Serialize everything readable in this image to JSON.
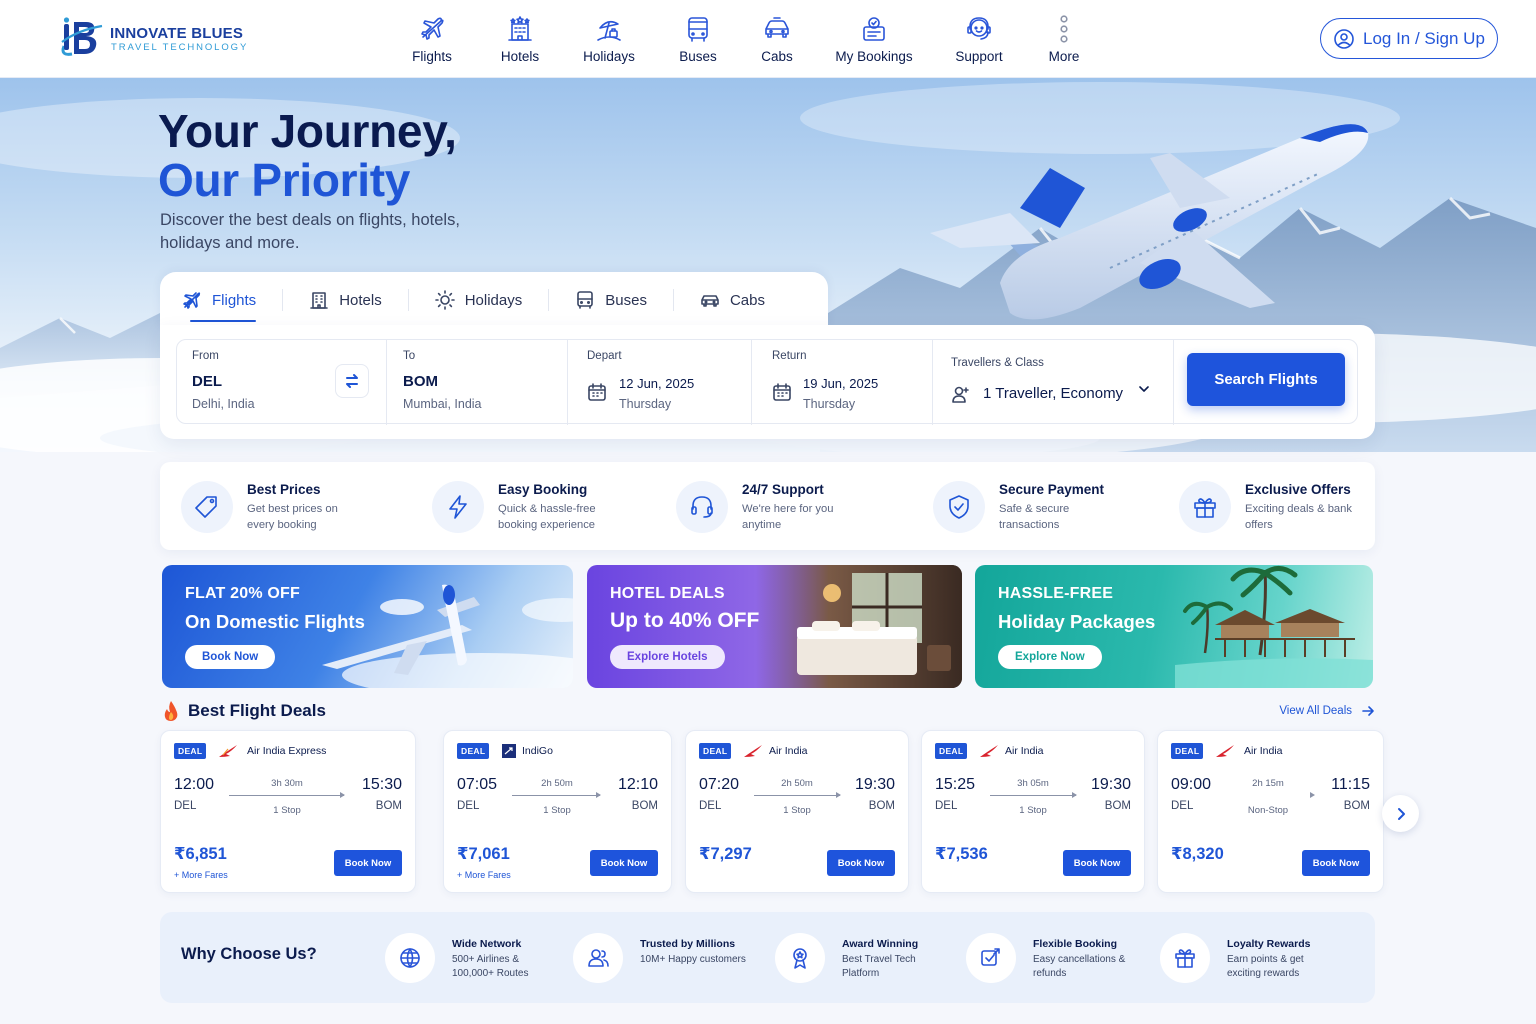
{
  "brand": {
    "name": "INNOVATE BLUES",
    "tagline": "TRAVEL TECHNOLOGY"
  },
  "nav": [
    {
      "label": "Flights",
      "icon": "flight-icon"
    },
    {
      "label": "Hotels",
      "icon": "hotel-icon"
    },
    {
      "label": "Holidays",
      "icon": "holiday-icon"
    },
    {
      "label": "Buses",
      "icon": "bus-icon"
    },
    {
      "label": "Cabs",
      "icon": "cab-icon"
    },
    {
      "label": "My Bookings",
      "icon": "bookings-icon"
    },
    {
      "label": "Support",
      "icon": "support-icon"
    },
    {
      "label": "More",
      "icon": "more-icon"
    }
  ],
  "login_label": "Log In / Sign Up",
  "hero": {
    "title_line1": "Your Journey,",
    "title_line2": "Our Priority",
    "subtitle": "Discover the best deals on flights, hotels, holidays and more."
  },
  "tabs": [
    "Flights",
    "Hotels",
    "Holidays",
    "Buses",
    "Cabs"
  ],
  "search": {
    "from": {
      "label": "From",
      "code": "DEL",
      "city": "Delhi, India"
    },
    "to": {
      "label": "To",
      "code": "BOM",
      "city": "Mumbai, India"
    },
    "depart": {
      "label": "Depart",
      "date": "12 Jun, 2025",
      "day": "Thursday"
    },
    "return": {
      "label": "Return",
      "date": "19 Jun, 2025",
      "day": "Thursday"
    },
    "travellers": {
      "label": "Travellers & Class",
      "value": "1 Traveller, Economy"
    },
    "button": "Search Flights"
  },
  "features": [
    {
      "title": "Best Prices",
      "desc": "Get best prices on every booking",
      "icon": "price-tag-icon"
    },
    {
      "title": "Easy Booking",
      "desc": "Quick & hassle-free booking experience",
      "icon": "lightning-icon"
    },
    {
      "title": "24/7 Support",
      "desc": "We're here for you anytime",
      "icon": "headset-icon"
    },
    {
      "title": "Secure Payment",
      "desc": "Safe & secure transactions",
      "icon": "shield-icon"
    },
    {
      "title": "Exclusive Offers",
      "desc": "Exciting deals & bank offers",
      "icon": "gift-icon"
    }
  ],
  "promos": [
    {
      "kicker": "FLAT 20% OFF",
      "headline": "On Domestic Flights",
      "button": "Book Now"
    },
    {
      "kicker": "HOTEL DEALS",
      "headline": "Up to 40% OFF",
      "button": "Explore Hotels"
    },
    {
      "kicker": "HASSLE-FREE",
      "headline": "Holiday Packages",
      "button": "Explore Now"
    }
  ],
  "deals": {
    "title": "Best Flight Deals",
    "view_all": "View All Deals",
    "badge": "DEAL",
    "book_label": "Book Now",
    "more_fares_label": "+ More Fares",
    "cards": [
      {
        "airline": "Air India Express",
        "dep": "12:00",
        "arr": "15:30",
        "from": "DEL",
        "to": "BOM",
        "duration": "3h 30m",
        "stops": "1 Stop",
        "price": "₹6,851",
        "more": true
      },
      {
        "airline": "IndiGo",
        "dep": "07:05",
        "arr": "12:10",
        "from": "DEL",
        "to": "BOM",
        "duration": "2h 50m",
        "stops": "1 Stop",
        "price": "₹7,061",
        "more": true
      },
      {
        "airline": "Air India",
        "dep": "07:20",
        "arr": "19:30",
        "from": "DEL",
        "to": "BOM",
        "duration": "2h 50m",
        "stops": "1 Stop",
        "price": "₹7,297",
        "more": false
      },
      {
        "airline": "Air India",
        "dep": "15:25",
        "arr": "19:30",
        "from": "DEL",
        "to": "BOM",
        "duration": "3h 05m",
        "stops": "1 Stop",
        "price": "₹7,536",
        "more": false
      },
      {
        "airline": "Air India",
        "dep": "09:00",
        "arr": "11:15",
        "from": "DEL",
        "to": "BOM",
        "duration": "2h 15m",
        "stops": "Non-Stop",
        "price": "₹8,320",
        "more": false
      }
    ]
  },
  "why": {
    "title": "Why Choose Us?",
    "items": [
      {
        "title": "Wide Network",
        "desc": "500+ Airlines & 100,000+ Routes",
        "icon": "globe-icon"
      },
      {
        "title": "Trusted by Millions",
        "desc": "10M+ Happy customers",
        "icon": "users-icon"
      },
      {
        "title": "Award Winning",
        "desc": "Best Travel Tech Platform",
        "icon": "award-icon"
      },
      {
        "title": "Flexible Booking",
        "desc": "Easy cancellations & refunds",
        "icon": "flexible-icon"
      },
      {
        "title": "Loyalty Rewards",
        "desc": "Earn points & get exciting rewards",
        "icon": "rewards-icon"
      }
    ]
  },
  "colors": {
    "accent": "#1e54dc",
    "navy": "#0b1b4d",
    "air_india_red": "#d9232d"
  }
}
